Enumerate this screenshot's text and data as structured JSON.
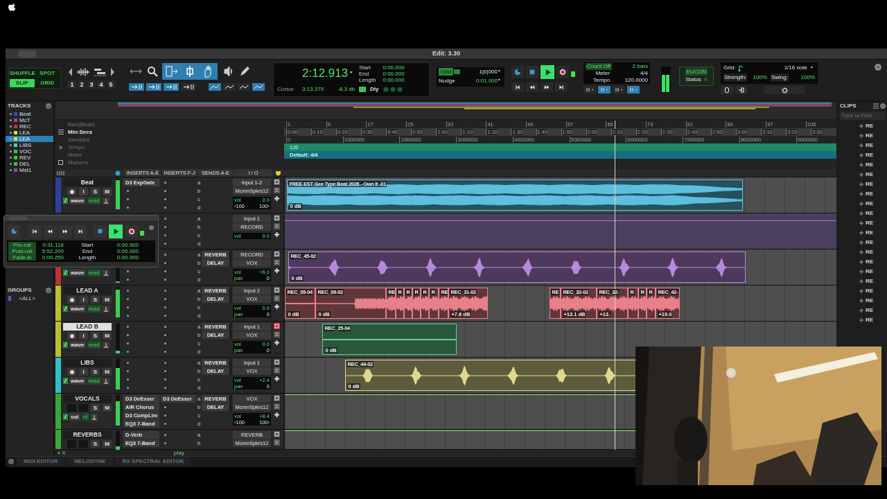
{
  "window": {
    "title": "Edit: 3.30"
  },
  "toolbar": {
    "edit_modes": [
      {
        "label": "SHUFFLE",
        "selected": false
      },
      {
        "label": "SPOT",
        "selected": false
      },
      {
        "label": "SLIP",
        "selected": true
      },
      {
        "label": "GRID",
        "selected": false
      }
    ],
    "zoom_presets": [
      "1",
      "2",
      "3",
      "4",
      "5"
    ],
    "counter": {
      "main": "2:12.913",
      "rows": [
        {
          "label": "Start",
          "value": "0:00.000"
        },
        {
          "label": "End",
          "value": "0:00.000"
        },
        {
          "label": "Length",
          "value": "0:00.000"
        }
      ],
      "cursor_label": "Cursor",
      "cursor": "3:13.375",
      "peak": "-8.3 db",
      "delay": "Dly"
    },
    "grid_nudge": {
      "grid_label": "Grid",
      "grid_value": "1|0|000",
      "nudge_label": "Nudge",
      "nudge_value": "0:01.000"
    },
    "midi": [
      {
        "label": "Count Off",
        "value": "2 bars"
      },
      {
        "label": "Meter",
        "value": "4/4"
      },
      {
        "label": "Tempo",
        "value": "120.0000"
      }
    ],
    "eucon": {
      "label": "EUCON",
      "status": "Status"
    },
    "grid_settings": {
      "grid_label": "Grid:",
      "grid_value": "1/16 note",
      "strength_label": "Strength:",
      "strength": "100%",
      "swing_label": "Swing:",
      "swing": "100%"
    }
  },
  "tracks_panel": {
    "title": "TRACKS",
    "items": [
      {
        "name": "Beat",
        "color": "#3a4bb0",
        "selected": false
      },
      {
        "name": "McT",
        "color": "#7a4fc0",
        "selected": false
      },
      {
        "name": "REC",
        "color": "#d0302a",
        "selected": false
      },
      {
        "name": "LEA",
        "color": "#e0e040",
        "selected": false
      },
      {
        "name": "LEA",
        "color": "#e0e040",
        "selected": true
      },
      {
        "name": "LIBS",
        "color": "#40d8d0",
        "selected": false
      },
      {
        "name": "VOC",
        "color": "#40c040",
        "selected": false
      },
      {
        "name": "REV",
        "color": "#40c040",
        "selected": false
      },
      {
        "name": "DEL",
        "color": "#40c040",
        "selected": false
      },
      {
        "name": "Mst1",
        "color": "#7a4fc0",
        "selected": false
      }
    ]
  },
  "groups_panel": {
    "title": "GROUPS",
    "items": [
      "<ALL>"
    ]
  },
  "rulers": {
    "bars_label": "Bars|Beats",
    "bars": [
      "1",
      "9",
      "17",
      "25",
      "33",
      "41",
      "49",
      "57",
      "65",
      "73",
      "81",
      "89",
      "97",
      "105"
    ],
    "minsecs_label": "Min:Secs",
    "minsecs": [
      "0:00",
      "0:10",
      "0:20",
      "0:30",
      "0:40",
      "0:50",
      "1:00",
      "1:10",
      "1:20",
      "1:30",
      "1:40",
      "1:50",
      "2:00",
      "2:10",
      "2:20",
      "2:30",
      "2:40",
      "2:50",
      "3:00",
      "3:10",
      "3:20",
      "3:30"
    ],
    "samples_label": "Samples",
    "samples": [
      "0",
      "1000000",
      "2000000",
      "3000000",
      "4000000",
      "5000000",
      "6000000",
      "7000000",
      "8000000",
      "9000000"
    ],
    "tempo_label": "Tempo",
    "tempo": "120",
    "meter_label": "Meter",
    "meter": "Default: 4/4",
    "markers_label": "Markers"
  },
  "columns": [
    "INSERTS A-E",
    "INSERTS F-J",
    "SENDS A-E",
    "I / O"
  ],
  "tracks": [
    {
      "name": "Beat",
      "kind": "audio",
      "color": "#2f3f9e",
      "selected": false,
      "input_monitor": "I",
      "solo": "S",
      "mute": "M",
      "view": "wave",
      "automation": "read",
      "meter": {
        "level": 0.95
      },
      "inserts_ae": [
        "D3 ExpGate"
      ],
      "send_letters": [
        "a",
        "b",
        "c",
        "d"
      ],
      "input": "Input 1-2",
      "output": "McmnSpkrs12",
      "vol_label": "vol",
      "vol": "0.0",
      "pan": [
        "‹100",
        "100›"
      ],
      "record_armed": false,
      "clips": [
        {
          "name": "FREE EST Gee Type Beat 2026 -  Own It -01",
          "gain": "0 dB",
          "color": "#5cbfe0",
          "kind": "stereo"
        }
      ]
    },
    {
      "kind": "instrument",
      "color": "#4b3f5e",
      "send_letters": [
        "a",
        "b",
        "c",
        "d"
      ],
      "input": "Input 1",
      "output": "RECORD",
      "vol_label": "vol",
      "vol": "0.0",
      "record_armed": false
    },
    {
      "kind": "audio",
      "color": "#c0302e",
      "view": "wave",
      "automation": "read",
      "meter": {
        "level": 0.1
      },
      "sends": [
        "REVERB",
        "DELAY"
      ],
      "send_letters": [
        "a",
        "b",
        "c",
        "d"
      ],
      "input": "RECORD",
      "output": "VOX",
      "vol_label": "vol",
      "vol": "+6.0",
      "pan_label": "pan",
      "pan": [
        "0"
      ],
      "record_armed": false,
      "clips": [
        {
          "name": "REC_45-02",
          "gain": "0 dB",
          "color": "#b888dc",
          "kind": "sparse"
        }
      ]
    },
    {
      "name": "LEAD A",
      "kind": "audio",
      "color": "#b8c030",
      "selected": false,
      "input_monitor": "I",
      "solo": "S",
      "mute": "M",
      "view": "wave",
      "automation": "read",
      "meter": {
        "level": 0.9
      },
      "sends": [
        "REVERB",
        "DELAY"
      ],
      "send_letters": [
        "a",
        "b",
        "c",
        "d"
      ],
      "input": "Input 2",
      "output": "VOX",
      "vol_label": "vol",
      "vol": "0.0",
      "pan_label": "pan",
      "pan": [
        "0"
      ],
      "record_armed": false,
      "clips": [
        {
          "name": "REC_05-04",
          "gain": "0 dB",
          "color": "#e8808a",
          "kind": "flat"
        },
        {
          "name": "REC_09-02",
          "gain": "0 dB",
          "color": "#e8808a",
          "kind": "rise"
        },
        {
          "name": "RE",
          "color": "#e8808a",
          "kind": "dense"
        },
        {
          "name": "R",
          "color": "#e8808a",
          "kind": "dense"
        },
        {
          "name": "R",
          "color": "#e8808a",
          "kind": "dense"
        },
        {
          "name": "R",
          "color": "#e8808a",
          "kind": "dense"
        },
        {
          "name": "R",
          "color": "#e8808a",
          "kind": "dense"
        },
        {
          "name": "R",
          "color": "#e8808a",
          "kind": "dense"
        },
        {
          "name": "RE",
          "color": "#e8808a",
          "kind": "dense"
        },
        {
          "name": "REC_31-02",
          "gain": "+7.8 dB",
          "color": "#e8808a",
          "kind": "dense"
        },
        {
          "name": "RE",
          "color": "#e8808a",
          "kind": "dense"
        },
        {
          "name": "REC_32-02",
          "gain": "+13.1 dB",
          "color": "#e8808a",
          "kind": "dense"
        },
        {
          "name": "REC_32-",
          "gain": "+13.",
          "color": "#e8808a",
          "kind": "dense"
        },
        {
          "name": "R",
          "color": "#e8808a",
          "kind": "dense"
        },
        {
          "name": "R",
          "color": "#e8808a",
          "kind": "dense"
        },
        {
          "name": "R",
          "color": "#e8808a",
          "kind": "dense"
        },
        {
          "name": "REC_42-",
          "gain": "+19.0",
          "color": "#e8808a",
          "kind": "dense"
        }
      ]
    },
    {
      "name": "LEAD B",
      "kind": "audio",
      "color": "#b8c030",
      "selected": true,
      "input_monitor": "I",
      "solo": "S",
      "mute": "M",
      "view": "wave",
      "automation": "read",
      "meter": {
        "level": 0.1
      },
      "sends": [
        "REVERB",
        "DELAY"
      ],
      "send_letters": [
        "a",
        "b",
        "c",
        "d"
      ],
      "input": "Input 1",
      "output": "VOX",
      "vol_label": "vol",
      "vol": "0.0",
      "pan_label": "pan",
      "pan": [
        "0"
      ],
      "record_armed": true,
      "clips": [
        {
          "name": "REC_25-04",
          "gain": "0 dB",
          "color": "#5fd08a",
          "kind": "flat"
        }
      ]
    },
    {
      "name": "LIBS",
      "kind": "audio",
      "color": "#30c0c8",
      "selected": false,
      "input_monitor": "I",
      "solo": "S",
      "mute": "M",
      "view": "wave",
      "automation": "read",
      "meter": {
        "level": 0.7
      },
      "sends": [
        "REVERB",
        "DELAY"
      ],
      "send_letters": [
        "a",
        "b",
        "c",
        "d"
      ],
      "input": "Input 1",
      "output": "VOX",
      "vol_label": "vol",
      "vol": "+2.4",
      "pan_label": "pan",
      "pan": [
        "0"
      ],
      "record_armed": false,
      "clips": [
        {
          "name": "REC_44-02",
          "gain": "0 dB",
          "color": "#e0d890",
          "kind": "sparse"
        }
      ]
    },
    {
      "name": "VOCALS",
      "kind": "aux",
      "color": "#38a838",
      "selected": false,
      "solo": "S",
      "mute": "M",
      "view": "vol",
      "automation": "rd",
      "meter": {
        "level": 0.8
      },
      "inserts_ae": [
        "D3 DeEsser",
        "AIR Chorus",
        "D3 CompLim",
        "EQ3 7-Band"
      ],
      "inserts_fj": [
        "D3 DeEsser"
      ],
      "sends": [
        "REVERB",
        "DELAY"
      ],
      "send_letters": [
        "a",
        "b",
        "c",
        "d"
      ],
      "input": "VOX",
      "output": "McmnSpkrs12",
      "vol_label": "vol",
      "vol": "+8.4",
      "pan": [
        "‹100",
        "100›"
      ],
      "record_armed": false
    },
    {
      "name": "REVERBS",
      "kind": "aux",
      "color": "#38a838",
      "selected": false,
      "solo": "S",
      "mute": "M",
      "meter": {
        "level": 0.5
      },
      "inserts_ae": [
        "D-Verb",
        "EQ3 7-Band"
      ],
      "send_letters": [
        "a",
        "b"
      ],
      "input": "REVERB",
      "output": "McmnSpkrs12",
      "record_armed": false
    }
  ],
  "timeline_footer": "play",
  "clips_panel": {
    "title": "CLIPS",
    "search_placeholder": "Type to Find",
    "items": [
      "RE",
      "RE",
      "RE",
      "RE",
      "RE",
      "RE",
      "RE",
      "RE",
      "RE",
      "RE",
      "RE",
      "RE",
      "RE",
      "RE",
      "RE",
      "RE",
      "RE",
      "RE",
      "RE",
      "RE",
      "RE"
    ]
  },
  "floating_transport": {
    "rows": [
      {
        "label": "Pre-roll",
        "value": "0:31.116"
      },
      {
        "label": "Post-roll",
        "value": "5:52.200"
      },
      {
        "label": "Fade-in",
        "value": "0:00.250"
      }
    ],
    "range": [
      {
        "label": "Start",
        "value": "0:00.000"
      },
      {
        "label": "End",
        "value": "0:00.000"
      },
      {
        "label": "Length",
        "value": "0:00.000"
      }
    ]
  },
  "bottom_tabs": [
    "MIDI EDITOR",
    "MELODYNE",
    "RX SPECTRAL EDITOR"
  ],
  "webcam": {
    "kind": "picture"
  }
}
